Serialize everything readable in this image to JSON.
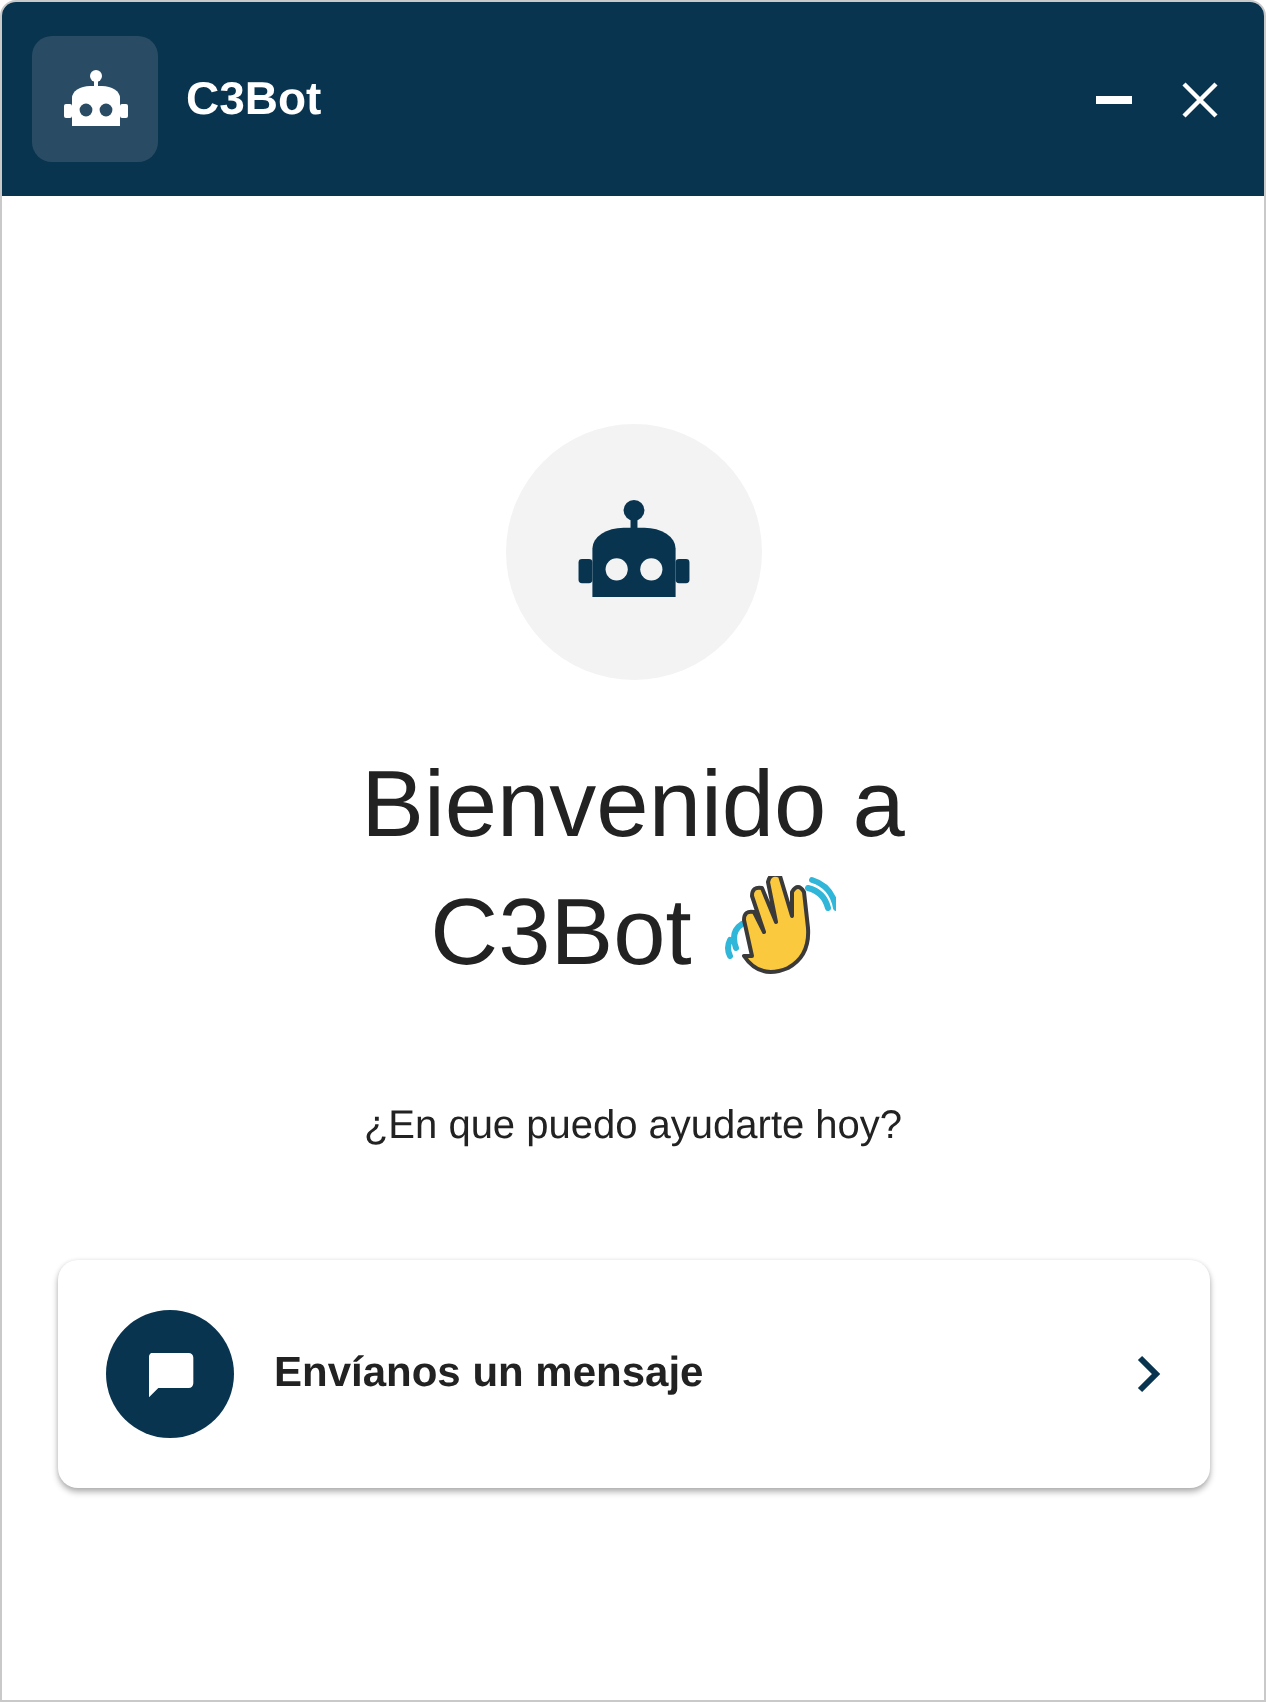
{
  "window": {
    "title": "C3Bot"
  },
  "welcome": {
    "heading_line1": "Bienvenido a",
    "heading_line2": "C3Bot",
    "subtitle": "¿En que puedo ayudarte hoy?"
  },
  "actions": [
    {
      "label": "Envíanos un mensaje"
    }
  ]
}
